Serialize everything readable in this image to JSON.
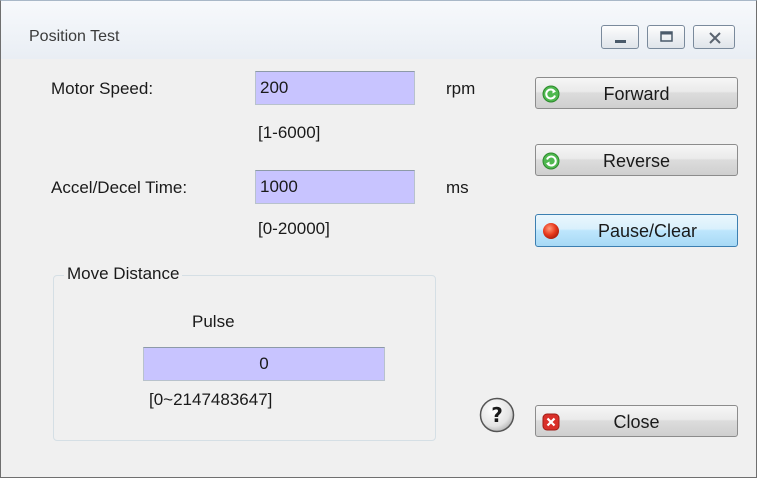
{
  "window": {
    "title": "Position Test",
    "controls": {
      "minimize_icon": "minimize-icon",
      "maximize_icon": "maximize-icon",
      "close_icon": "close-x-icon"
    }
  },
  "motor_speed": {
    "label": "Motor Speed:",
    "value": "200",
    "unit": "rpm",
    "range": "[1-6000]"
  },
  "accel_decel": {
    "label": "Accel/Decel Time:",
    "value": "1000",
    "unit": "ms",
    "range": "[0-20000]"
  },
  "move_distance": {
    "group_label": "Move Distance",
    "pulse_label": "Pulse",
    "value": "0",
    "range": "[0~2147483647]"
  },
  "buttons": {
    "forward": {
      "label": "Forward",
      "icon": "forward-arrow-icon",
      "icon_color": "#3aa53a"
    },
    "reverse": {
      "label": "Reverse",
      "icon": "reverse-arrow-icon",
      "icon_color": "#3aa53a"
    },
    "pause_clear": {
      "label": "Pause/Clear",
      "icon": "red-circle-icon",
      "icon_color": "#e83a1e"
    },
    "close": {
      "label": "Close",
      "icon": "close-x-icon",
      "icon_color": "#d9302a"
    },
    "help_icon": "help-question-icon"
  },
  "colors": {
    "field_bg": "#c8c4ff",
    "focus_border": "#3c7fb1"
  }
}
